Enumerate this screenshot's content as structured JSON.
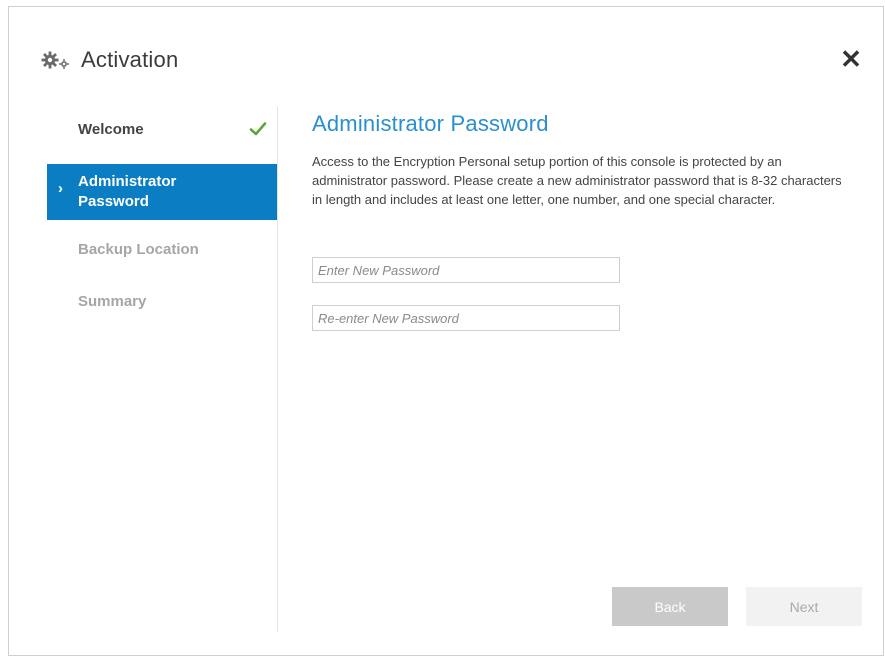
{
  "window": {
    "title": "Activation",
    "close_label": "✕"
  },
  "sidebar": {
    "items": [
      {
        "label": "Welcome",
        "state": "completed"
      },
      {
        "label": "Administrator Password",
        "state": "active"
      },
      {
        "label": "Backup Location",
        "state": "pending"
      },
      {
        "label": "Summary",
        "state": "pending"
      }
    ]
  },
  "main": {
    "heading": "Administrator Password",
    "description": "Access to the Encryption Personal setup portion of this console is protected by an administrator password.  Please create a new administrator password that is 8-32 characters in length and includes  at least one letter, one number, and one special character.",
    "fields": {
      "new_password_placeholder": "Enter New Password",
      "reenter_password_placeholder": "Re-enter New Password",
      "new_password_value": "",
      "reenter_password_value": ""
    }
  },
  "buttons": {
    "back_label": "Back",
    "next_label": "Next"
  },
  "colors": {
    "accent": "#0b7dc2",
    "heading": "#2a8fd0",
    "check": "#5aa832",
    "disabled_button": "#c9c9c9"
  },
  "icons": {
    "title": "gears-icon",
    "check": "checkmark-icon",
    "active_indicator": "chevron-right-icon",
    "close": "close-icon"
  }
}
